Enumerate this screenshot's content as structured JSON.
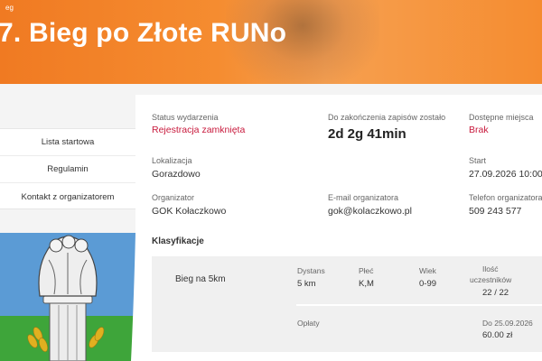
{
  "header": {
    "kicker": "eg",
    "title": "7. Bieg po Złote RUNo"
  },
  "side_menu": {
    "items": [
      {
        "label": "Lista startowa"
      },
      {
        "label": "Regulamin"
      },
      {
        "label": "Kontakt z organizatorem"
      }
    ]
  },
  "event": {
    "status_label": "Status wydarzenia",
    "status_value": "Rejestracja zamknięta",
    "countdown_label": "Do zakończenia zapisów zostało",
    "countdown_value": "2d 2g 41min",
    "places_label": "Dostępne miejsca",
    "places_value": "Brak",
    "location_label": "Lokalizacja",
    "location_value": "Gorazdowo",
    "start_label": "Start",
    "start_value": "27.09.2026 10:00",
    "organizer_label": "Organizator",
    "organizer_value": "GOK Kołaczkowo",
    "email_label": "E-mail organizatora",
    "email_value": "gok@kolaczkowo.pl",
    "phone_label": "Telefon organizatora",
    "phone_value": "509 243 577"
  },
  "classifications": {
    "title": "Klasyfikacje",
    "items": [
      {
        "name": "Bieg na 5km",
        "distance_label": "Dystans",
        "distance_value": "5 km",
        "gender_label": "Płeć",
        "gender_value": "K,M",
        "age_label": "Wiek",
        "age_value": "0-99",
        "participants_label_1": "Ilość",
        "participants_label_2": "uczestników",
        "participants_value": "22 / 22",
        "fees_label": "Opłaty",
        "fee_until": "Do 25.09.2026",
        "fee_amount": "60.00 zł"
      }
    ]
  },
  "colors": {
    "banner": "#f58c30",
    "accent_red": "#c8193c",
    "crest_sky": "#5b9bd5",
    "crest_grass": "#3ea53a",
    "crest_wheat": "#e0b020"
  }
}
